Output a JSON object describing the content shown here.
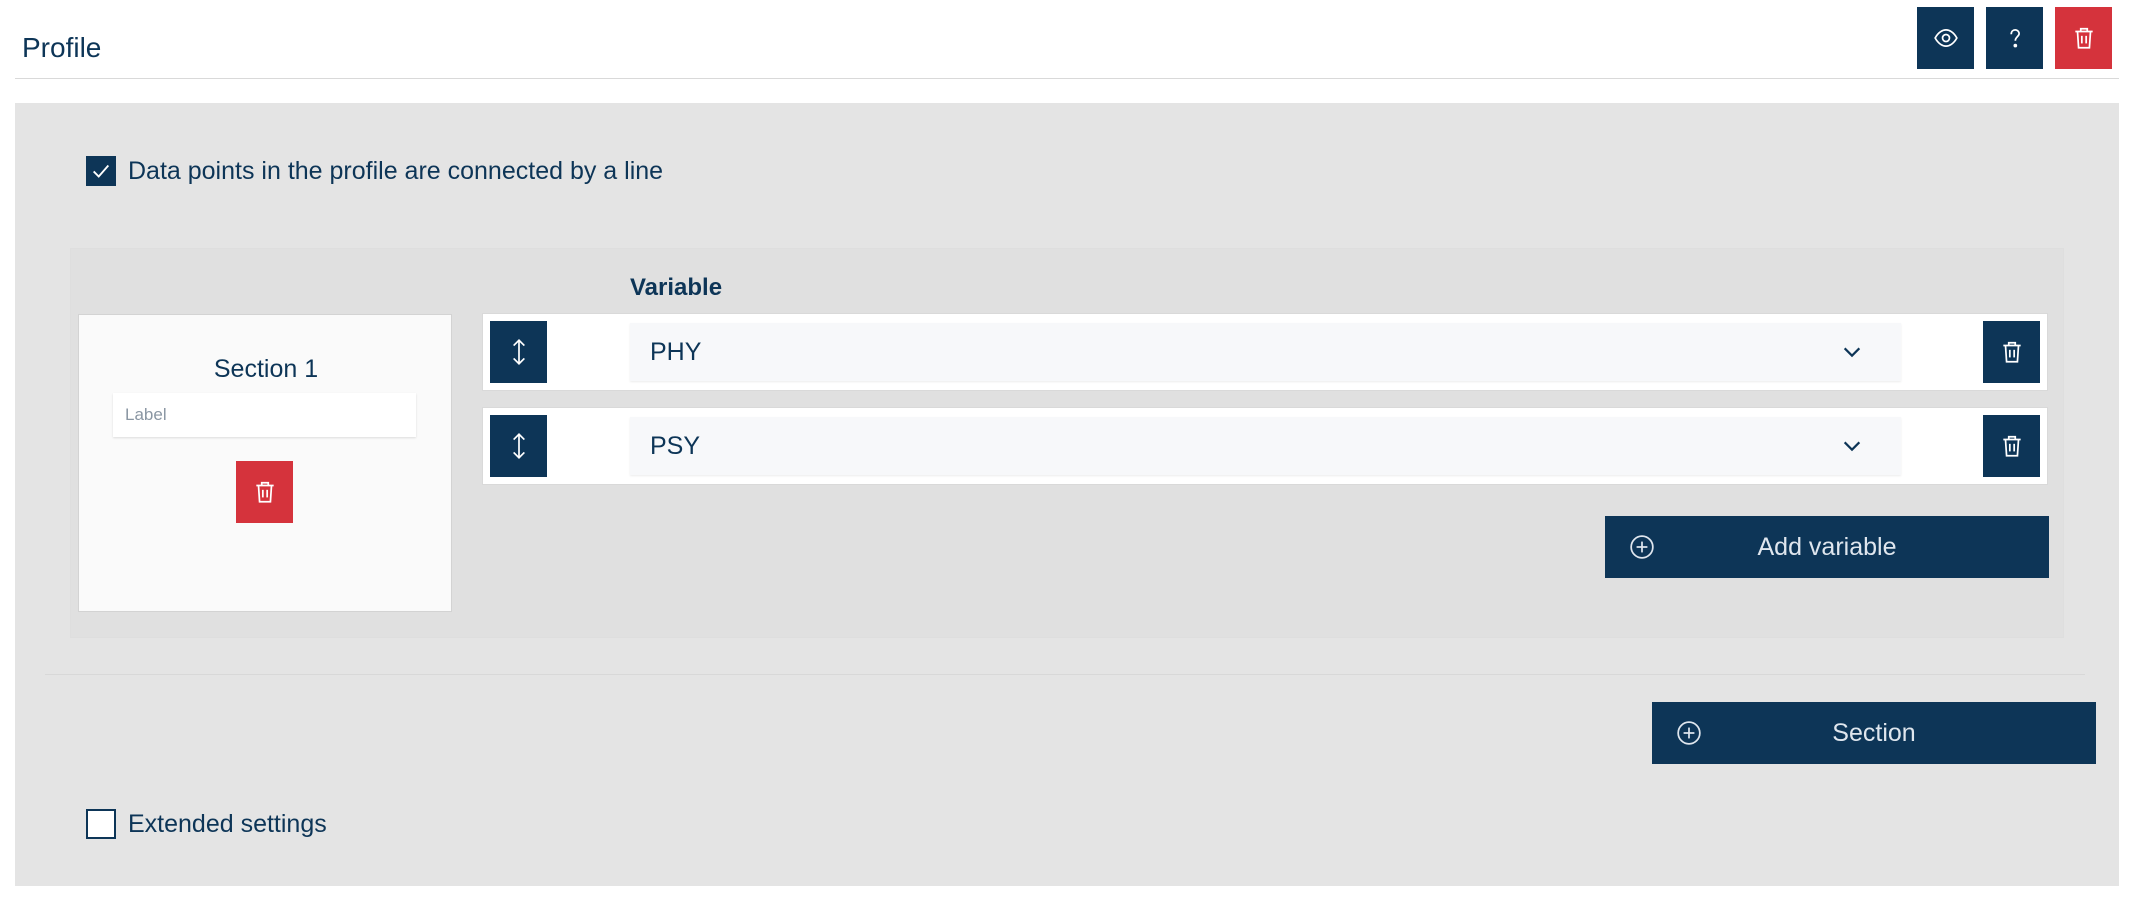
{
  "header": {
    "title": "Profile",
    "buttons": [
      {
        "icon": "eye-icon",
        "color": "#0d3557"
      },
      {
        "icon": "help-icon",
        "color": "#0d3557"
      },
      {
        "icon": "trash-icon",
        "color": "#d5333c"
      }
    ]
  },
  "settings": {
    "connect_points": {
      "label": "Data points in the profile are connected by a line",
      "checked": true
    },
    "extended": {
      "label": "Extended settings",
      "checked": false
    }
  },
  "section": {
    "title": "Section 1",
    "label_placeholder": "Label",
    "label_value": ""
  },
  "variables": {
    "header": "Variable",
    "rows": [
      {
        "value": "PHY"
      },
      {
        "value": "PSY"
      }
    ],
    "add_label": "Add variable"
  },
  "add_section_label": "Section",
  "colors": {
    "primary": "#0d3557",
    "danger": "#d5333c",
    "panel": "#e4e4e4"
  }
}
